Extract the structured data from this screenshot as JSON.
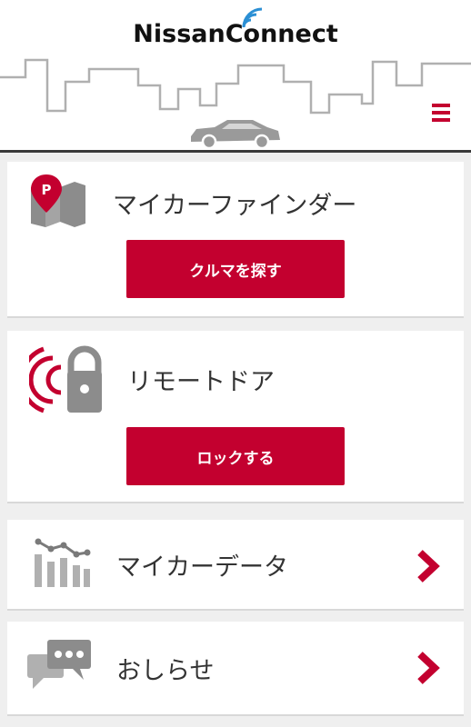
{
  "header": {
    "logo_text": "NissanConnect",
    "menu_icon": "hamburger-menu-icon"
  },
  "finder": {
    "title": "マイカーファインダー",
    "button_label": "クルマを探す",
    "icon": "map-pin-parking-icon",
    "pin_letter": "P"
  },
  "remote": {
    "title": "リモートドア",
    "button_label": "ロックする",
    "icon": "signal-lock-icon"
  },
  "mydata": {
    "title": "マイカーデータ",
    "icon": "bar-chart-icon"
  },
  "news": {
    "title": "おしらせ",
    "icon": "chat-bubbles-icon"
  },
  "colors": {
    "accent": "#c3002f",
    "icon_gray": "#8c8c8c",
    "text": "#333333"
  }
}
